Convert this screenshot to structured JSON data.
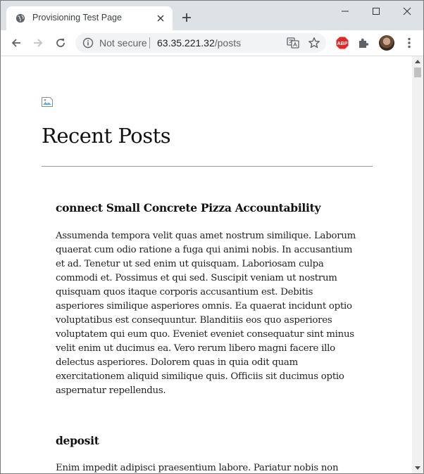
{
  "browser": {
    "tab_title": "Provisioning Test Page",
    "security_label": "Not secure",
    "url_host": "63.35.221.32",
    "url_path": "/posts",
    "extension_badge": "ABP"
  },
  "page": {
    "heading": "Recent Posts",
    "posts": [
      {
        "title": "connect Small Concrete Pizza Accountability",
        "body": "Assumenda tempora velit quas amet nostrum similique. Laborum quaerat cum odio ratione a fuga qui animi nobis. In accusantium et ad. Tenetur ut sed enim ut quisquam. Laboriosam culpa commodi et. Possimus et qui sed. Suscipit veniam ut nostrum quisquam quos itaque corporis accusantium est. Debitis asperiores similique asperiores omnis. Ea quaerat incidunt optio voluptatibus est consequuntur. Blanditiis eos quo asperiores voluptatem qui eum quo. Eveniet eveniet consequatur sint minus velit enim ut ducimus ea. Vero rerum libero magni facere illo delectus asperiores. Dolorem quas in quia odit quam exercitationem aliquid similique quis. Officiis sit ducimus optio aspernatur repellendus."
      },
      {
        "title": "deposit",
        "body": "Enim impedit adipisci praesentium labore. Pariatur nobis non rerum"
      }
    ]
  },
  "colors": {
    "tabstrip": "#dee1e6",
    "omnibox": "#f1f3f4",
    "abp_red": "#e32626",
    "text": "#222222"
  },
  "icons": [
    "globe-icon",
    "close-icon",
    "plus-icon",
    "minimize-icon",
    "maximize-icon",
    "window-close-icon",
    "back-icon",
    "forward-icon",
    "reload-icon",
    "info-icon",
    "translate-icon",
    "star-icon",
    "puzzle-icon",
    "menu-dots-icon",
    "broken-image-icon"
  ]
}
